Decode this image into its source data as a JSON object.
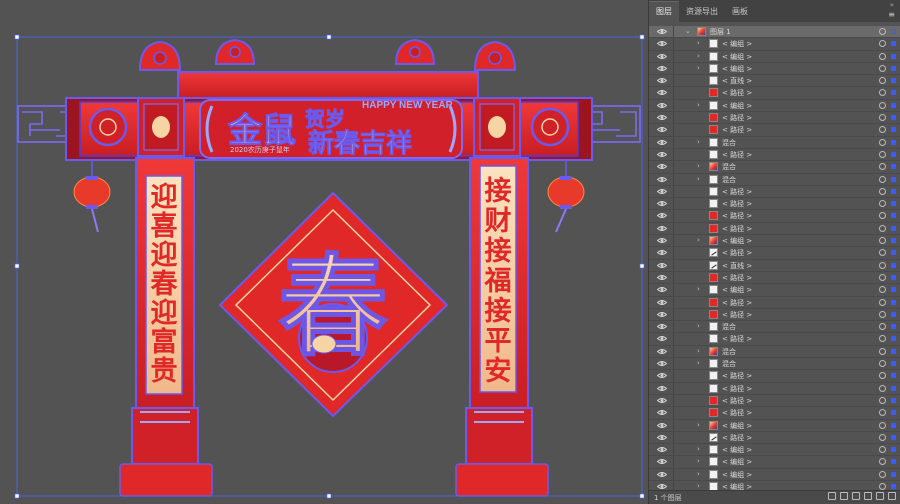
{
  "panel": {
    "tabs": [
      {
        "label": "图层",
        "active": true
      },
      {
        "label": "资源导出",
        "active": false
      },
      {
        "label": "画板",
        "active": false
      }
    ],
    "footer_count": "1 个图层"
  },
  "artwork": {
    "banner_title_1": "金鼠",
    "banner_title_2": "贺岁",
    "banner_title_3": "新春吉祥",
    "banner_english": "HAPPY NEW YEAR",
    "banner_subtitle": "2020农历庚子鼠年",
    "left_couplet": [
      "迎",
      "喜",
      "迎",
      "春",
      "迎",
      "富",
      "贵"
    ],
    "right_couplet": [
      "接",
      "财",
      "接",
      "福",
      "接",
      "平",
      "安"
    ],
    "center_character": "春"
  },
  "layers": [
    {
      "label": "图层 1",
      "thumb": "mixed",
      "expand": "open",
      "level": 0,
      "top": true,
      "sel": "hollow"
    },
    {
      "label": "< 编组 >",
      "thumb": "white",
      "expand": "closed",
      "level": 1
    },
    {
      "label": "< 编组 >",
      "thumb": "white",
      "expand": "closed",
      "level": 1
    },
    {
      "label": "< 编组 >",
      "thumb": "white",
      "expand": "closed",
      "level": 1
    },
    {
      "label": "< 直线 >",
      "thumb": "white",
      "expand": "none",
      "level": 1
    },
    {
      "label": "< 路径 >",
      "thumb": "red",
      "expand": "none",
      "level": 1
    },
    {
      "label": "< 编组 >",
      "thumb": "white",
      "expand": "closed",
      "level": 1
    },
    {
      "label": "< 路径 >",
      "thumb": "red",
      "expand": "none",
      "level": 1
    },
    {
      "label": "< 路径 >",
      "thumb": "red",
      "expand": "none",
      "level": 1
    },
    {
      "label": "混合",
      "thumb": "white",
      "expand": "closed",
      "level": 1
    },
    {
      "label": "< 路径 >",
      "thumb": "white",
      "expand": "none",
      "level": 1
    },
    {
      "label": "混合",
      "thumb": "mixed",
      "expand": "closed",
      "level": 1
    },
    {
      "label": "混合",
      "thumb": "white",
      "expand": "closed",
      "level": 1
    },
    {
      "label": "< 路径 >",
      "thumb": "white",
      "expand": "none",
      "level": 1
    },
    {
      "label": "< 路径 >",
      "thumb": "white",
      "expand": "none",
      "level": 1
    },
    {
      "label": "< 路径 >",
      "thumb": "red",
      "expand": "none",
      "level": 1
    },
    {
      "label": "< 路径 >",
      "thumb": "red",
      "expand": "none",
      "level": 1
    },
    {
      "label": "< 编组 >",
      "thumb": "mixed",
      "expand": "closed",
      "level": 1
    },
    {
      "label": "< 路径 >",
      "thumb": "line",
      "expand": "none",
      "level": 1
    },
    {
      "label": "< 直线 >",
      "thumb": "line",
      "expand": "none",
      "level": 1
    },
    {
      "label": "< 路径 >",
      "thumb": "red",
      "expand": "none",
      "level": 1
    },
    {
      "label": "< 编组 >",
      "thumb": "white",
      "expand": "closed",
      "level": 1
    },
    {
      "label": "< 路径 >",
      "thumb": "red",
      "expand": "none",
      "level": 1
    },
    {
      "label": "< 路径 >",
      "thumb": "red",
      "expand": "none",
      "level": 1
    },
    {
      "label": "混合",
      "thumb": "white",
      "expand": "closed",
      "level": 1
    },
    {
      "label": "< 路径 >",
      "thumb": "white",
      "expand": "none",
      "level": 1
    },
    {
      "label": "混合",
      "thumb": "mixed",
      "expand": "closed",
      "level": 1
    },
    {
      "label": "混合",
      "thumb": "white",
      "expand": "closed",
      "level": 1
    },
    {
      "label": "< 路径 >",
      "thumb": "white",
      "expand": "none",
      "level": 1
    },
    {
      "label": "< 路径 >",
      "thumb": "white",
      "expand": "none",
      "level": 1
    },
    {
      "label": "< 路径 >",
      "thumb": "red",
      "expand": "none",
      "level": 1
    },
    {
      "label": "< 路径 >",
      "thumb": "red",
      "expand": "none",
      "level": 1
    },
    {
      "label": "< 编组 >",
      "thumb": "mixed",
      "expand": "closed",
      "level": 1
    },
    {
      "label": "< 路径 >",
      "thumb": "line",
      "expand": "none",
      "level": 1
    },
    {
      "label": "< 编组 >",
      "thumb": "white",
      "expand": "closed",
      "level": 1
    },
    {
      "label": "< 编组 >",
      "thumb": "white",
      "expand": "closed",
      "level": 1
    },
    {
      "label": "< 编组 >",
      "thumb": "white",
      "expand": "closed",
      "level": 1
    },
    {
      "label": "< 编组 >",
      "thumb": "white",
      "expand": "closed",
      "level": 1
    }
  ],
  "colors": {
    "canvas_bg": "#535353",
    "red": "#e02828",
    "dark_red": "#9c1420",
    "blue": "#5a4ee8",
    "gold": "#f6d4a4",
    "selection": "#3b5bff"
  }
}
